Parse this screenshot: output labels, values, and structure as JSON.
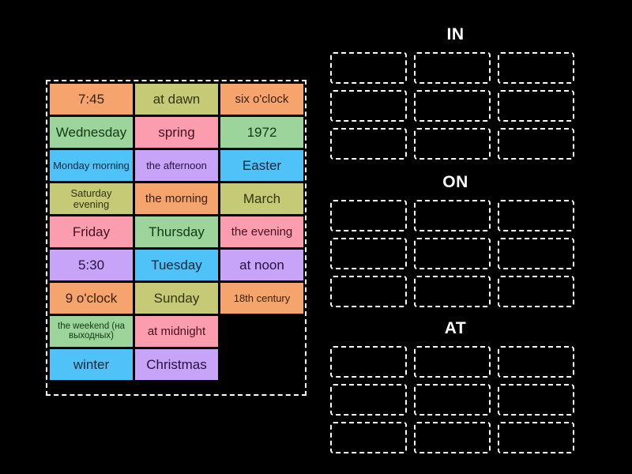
{
  "activity": {
    "type": "group-sort",
    "background_color": "#000000"
  },
  "palette": {
    "orange": {
      "bg": "#F4A46C",
      "fg": "#3A2208"
    },
    "green": {
      "bg": "#9CD49C",
      "fg": "#123A12"
    },
    "olive": {
      "bg": "#C6CA77",
      "fg": "#33360A"
    },
    "pink": {
      "bg": "#FB9CAF",
      "fg": "#45121F"
    },
    "lavender": {
      "bg": "#C7A4F7",
      "fg": "#261046"
    },
    "cyan": {
      "bg": "#4FC3F7",
      "fg": "#06293C"
    }
  },
  "tile_tray": {
    "name": "word-tile-tray",
    "columns": 3,
    "tiles": [
      {
        "label": "7:45",
        "color": "orange",
        "size": "normal"
      },
      {
        "label": "at dawn",
        "color": "olive",
        "size": "normal"
      },
      {
        "label": "six o'clock",
        "color": "orange",
        "size": "m"
      },
      {
        "label": "Wednesday",
        "color": "green",
        "size": "normal"
      },
      {
        "label": "spring",
        "color": "pink",
        "size": "normal"
      },
      {
        "label": "1972",
        "color": "green",
        "size": "normal"
      },
      {
        "label": "Monday morning",
        "color": "cyan",
        "size": "s"
      },
      {
        "label": "the afternoon",
        "color": "lavender",
        "size": "s"
      },
      {
        "label": "Easter",
        "color": "cyan",
        "size": "normal"
      },
      {
        "label": "Saturday evening",
        "color": "olive",
        "size": "s"
      },
      {
        "label": "the morning",
        "color": "orange",
        "size": "m"
      },
      {
        "label": "March",
        "color": "olive",
        "size": "normal"
      },
      {
        "label": "Friday",
        "color": "pink",
        "size": "normal"
      },
      {
        "label": "Thursday",
        "color": "green",
        "size": "normal"
      },
      {
        "label": "the evening",
        "color": "pink",
        "size": "m"
      },
      {
        "label": "5:30",
        "color": "lavender",
        "size": "normal"
      },
      {
        "label": "Tuesday",
        "color": "cyan",
        "size": "normal"
      },
      {
        "label": "at noon",
        "color": "lavender",
        "size": "normal"
      },
      {
        "label": "9 o'clock",
        "color": "orange",
        "size": "normal"
      },
      {
        "label": "Sunday",
        "color": "olive",
        "size": "normal"
      },
      {
        "label": "18th century",
        "color": "orange",
        "size": "s"
      },
      {
        "label": "the weekend (на выходных)",
        "color": "green",
        "size": "xs"
      },
      {
        "label": "at midnight",
        "color": "pink",
        "size": "m"
      },
      {
        "label": "",
        "color": "empty",
        "size": "normal"
      },
      {
        "label": "winter",
        "color": "cyan",
        "size": "normal"
      },
      {
        "label": "Christmas",
        "color": "lavender",
        "size": "normal"
      },
      {
        "label": "",
        "color": "empty",
        "size": "normal"
      }
    ]
  },
  "groups": [
    {
      "title": "IN",
      "zone_count": 9,
      "zone_columns": 3
    },
    {
      "title": "ON",
      "zone_count": 9,
      "zone_columns": 3
    },
    {
      "title": "AT",
      "zone_count": 9,
      "zone_columns": 3
    }
  ]
}
